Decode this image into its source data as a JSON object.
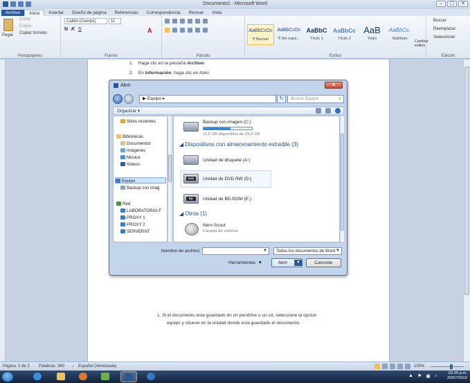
{
  "window": {
    "title": "Documento1 - Microsoft Word",
    "controls": [
      "–",
      "▢",
      "✕"
    ]
  },
  "ribbon_tabs": [
    "Archivo",
    "Inicio",
    "Insertar",
    "Diseño de página",
    "Referencias",
    "Correspondencia",
    "Revisar",
    "Vista"
  ],
  "ribbon": {
    "clipboard": {
      "paste": "Pegar",
      "cut": "Cortar",
      "copy": "Copiar",
      "format_painter": "Copiar formato",
      "label": "Portapapeles"
    },
    "font": {
      "name": "Calibri (Cuerpo)",
      "size": "11",
      "label": "Fuente",
      "bold": "N",
      "italic": "K",
      "underline": "S"
    },
    "paragraph": {
      "label": "Párrafo"
    },
    "styles": {
      "label": "Estilos",
      "items": [
        {
          "sample": "AaBbCcDc",
          "name": "¶ Normal"
        },
        {
          "sample": "AaBbCcDc",
          "name": "¶ Sin espa..."
        },
        {
          "sample": "AaBbC",
          "name": "Título 1"
        },
        {
          "sample": "AaBbCc",
          "name": "Título 2"
        },
        {
          "sample": "AaB",
          "name": "Título"
        },
        {
          "sample": "AaBbCc.",
          "name": "Subtítulo"
        }
      ],
      "change_styles": "Cambiar estilos"
    },
    "editing": {
      "label": "Edición",
      "find": "Buscar",
      "replace": "Reemplazar",
      "select": "Seleccionar"
    }
  },
  "document": {
    "steps": [
      {
        "num": "1.",
        "pre": "Haga clic en la pestaña ",
        "bold": "Archivo",
        "post": "."
      },
      {
        "num": "2.",
        "pre": "En ",
        "bold": "Información",
        "post": ", haga clic en Abrir."
      }
    ],
    "note_line1": "1.   Si el documento esta guardado en un pendrive o un cd, seleccione la opcion",
    "note_line2": "equipo y situese en la unidad donde esta guardado el documento."
  },
  "dialog": {
    "title": "Abrir",
    "close": "x",
    "address": "▶ Equipo ▸",
    "search_placeholder": "Buscar Equipo",
    "organize": "Organizar ▾",
    "nav_items": [
      {
        "label": "Sitios recientes",
        "color": "#e2a83a"
      },
      {
        "label": "Bibliotecas",
        "color": "#e8c36a"
      },
      {
        "label": "Documentos",
        "color": "#d9c58f"
      },
      {
        "label": "Imágenes",
        "color": "#6fa3d6"
      },
      {
        "label": "Música",
        "color": "#4f8fd0"
      },
      {
        "label": "Videos",
        "color": "#3b5d8f"
      },
      {
        "label": "Equipo",
        "color": "#3f7cc7"
      },
      {
        "label": "Backup con imag",
        "color": "#8aa3bf"
      },
      {
        "label": "Red",
        "color": "#4a8f4a"
      },
      {
        "label": "LABORATORIO-F",
        "color": "#3f7cc7"
      },
      {
        "label": "PROXY 1",
        "color": "#3f7cc7"
      },
      {
        "label": "PROXY 2",
        "color": "#3f7cc7"
      },
      {
        "label": "SERVERNT",
        "color": "#3f7cc7"
      }
    ],
    "drive_c": {
      "name": "Backup con imagen (C:)",
      "free": "11,5 GB disponibles de 25,6 GB",
      "used_fraction": 0.55
    },
    "removable_header": "Dispositivos con almacenamiento extraíble (3)",
    "removable": [
      {
        "name": "Unidad de disquete (A:)",
        "badge": ""
      },
      {
        "name": "Unidad de DVD RW (D:)",
        "badge": "DVD"
      },
      {
        "name": "Unidad de BD-ROM (E:)",
        "badge": "BD"
      }
    ],
    "others_header": "Otros (1)",
    "others": [
      {
        "name": "Nero Scout",
        "sub": "Carpeta de sistema"
      }
    ],
    "filename_label": "Nombre de archivo:",
    "filename_value": "",
    "filetype": "Todos los documentos de Word",
    "tools": "Herramientas",
    "open": "Abrir",
    "cancel": "Cancelar"
  },
  "status": {
    "page": "Página: 2 de 2",
    "words": "Palabras: 360",
    "language": "Español (Venezuela)",
    "zoom": "100%"
  },
  "taskbar": {
    "time": "03:39 p.m.",
    "date": "20/07/2010"
  }
}
